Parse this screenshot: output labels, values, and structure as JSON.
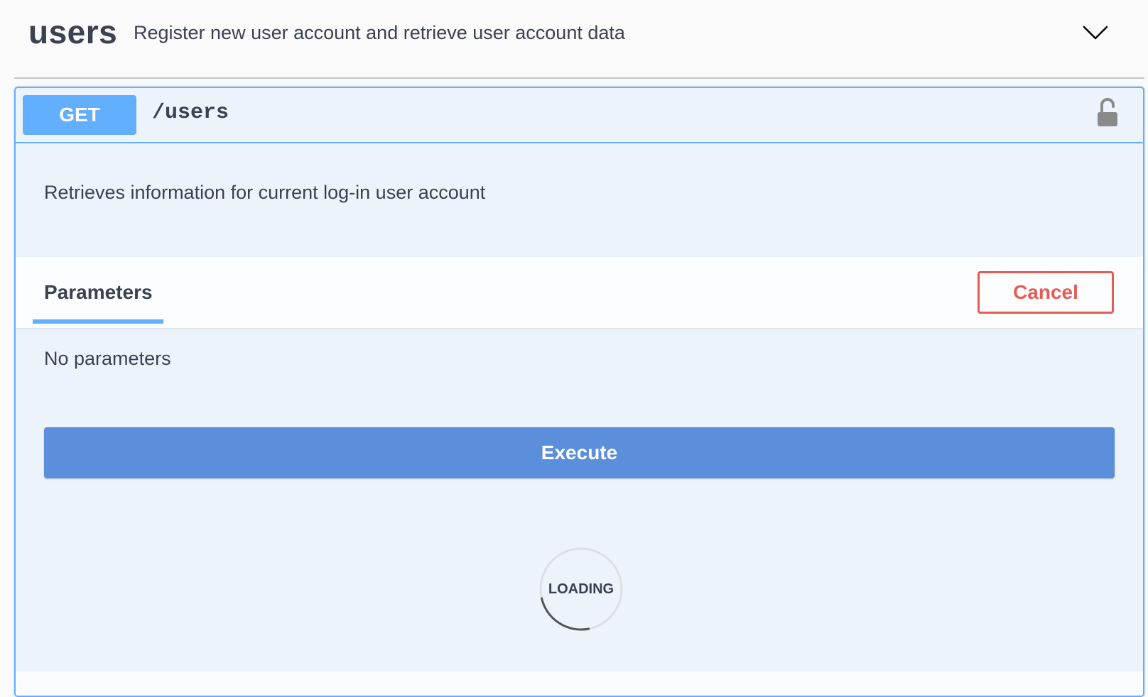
{
  "tag": {
    "name": "users",
    "description": "Register new user account and retrieve user account data",
    "toggle_icon": "chevron-down-icon"
  },
  "operation": {
    "method": "GET",
    "path": "/users",
    "lock_icon": "unlocked-padlock-icon",
    "description": "Retrieves information for current log-in user account"
  },
  "parameters": {
    "tab_label": "Parameters",
    "cancel_label": "Cancel",
    "empty_text": "No parameters"
  },
  "execute": {
    "label": "Execute"
  },
  "loading": {
    "label": "LOADING"
  },
  "colors": {
    "get_method": "#61affe",
    "execute": "#5c8fdb",
    "cancel": "#e75b56",
    "opblock_bg": "#edf3fb"
  }
}
